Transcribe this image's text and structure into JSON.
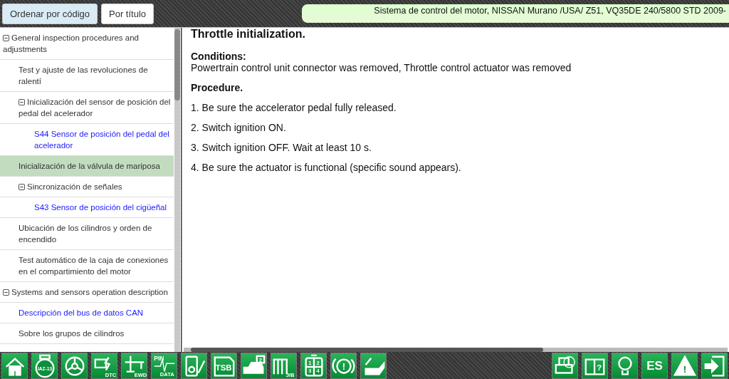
{
  "top_bar": {
    "sort_buttons": [
      {
        "label": "Ordenar por código",
        "selected": true
      },
      {
        "label": "Por título",
        "selected": false
      }
    ],
    "vehicle_info": "Sistema de control del motor, NISSAN Murano /USA/ Z51, VQ35DE 240/5800 STD 2009-"
  },
  "sidebar": {
    "items": [
      {
        "label": "General inspection procedures and adjustments",
        "kind": "topic",
        "expanded": true,
        "selected": false,
        "children": [
          {
            "label": " Test y ajuste de las revoluciones de ralentí",
            "kind": "topic",
            "expanded": false,
            "selected": false
          },
          {
            "label": "Inicialización del sensor de posición del pedal del acelerador",
            "kind": "topic",
            "expanded": true,
            "selected": false,
            "children": [
              {
                "label": " S44 Sensor de posición del pedal del acelerador",
                "kind": "link",
                "expanded": false,
                "selected": false
              }
            ]
          },
          {
            "label": "Inicialización de la válvula de mariposa",
            "kind": "topic",
            "expanded": false,
            "selected": true
          },
          {
            "label": "Sincronización de señales",
            "kind": "topic",
            "expanded": true,
            "selected": false,
            "children": [
              {
                "label": "S43 Sensor de posición del cigüeñal",
                "kind": "link",
                "expanded": false,
                "selected": false
              }
            ]
          },
          {
            "label": "Ubicación de los cilindros y orden de encendido",
            "kind": "topic",
            "expanded": false,
            "selected": false
          },
          {
            "label": "Test automático de la caja de conexiones en el compartimiento del motor",
            "kind": "topic",
            "expanded": false,
            "selected": false
          }
        ]
      },
      {
        "label": "Systems and sensors operation description",
        "kind": "topic",
        "expanded": true,
        "selected": false,
        "children": [
          {
            "label": "Descripción del bus de datos CAN",
            "kind": "link",
            "expanded": false,
            "selected": false
          },
          {
            "label": "Sobre los grupos de cilindros",
            "kind": "topic",
            "expanded": false,
            "selected": false
          }
        ]
      }
    ]
  },
  "document": {
    "title": "Throttle initialization.",
    "conditions": {
      "heading": "Conditions:",
      "text": "Powertrain control unit connector was removed, Throttle control actuator was removed"
    },
    "procedure": {
      "heading": "Procedure.",
      "steps": [
        "1. Be sure the accelerator pedal fully released.",
        "2. Switch ignition ON.",
        "3. Switch ignition OFF. Wait at least 10 s.",
        "4. Be sure the actuator is functional (specific sound appears)."
      ]
    }
  },
  "toolbar": {
    "left": [
      {
        "kind": "home"
      },
      {
        "kind": "engine",
        "labels": [
          "IAZ-13"
        ]
      },
      {
        "kind": "wheel"
      },
      {
        "kind": "dtc",
        "labels": [
          "DTC"
        ]
      },
      {
        "kind": "ewd",
        "labels": [
          "EWD"
        ]
      },
      {
        "kind": "pin",
        "labels": [
          "PIN",
          "DATA"
        ]
      },
      {
        "kind": "meter"
      },
      {
        "kind": "tsb",
        "labels": [
          "TSB"
        ]
      },
      {
        "kind": "car",
        "labels": [
          "2"
        ]
      },
      {
        "kind": "jb",
        "labels": [
          "J/B"
        ]
      },
      {
        "kind": "grid",
        "labels": [
          "1",
          "2",
          "3",
          "4"
        ]
      },
      {
        "kind": "brake",
        "labels": [
          "!"
        ]
      },
      {
        "kind": "oil"
      }
    ],
    "right": [
      {
        "kind": "print"
      },
      {
        "kind": "manual",
        "labels": [
          "?"
        ]
      },
      {
        "kind": "bulb"
      },
      {
        "kind": "lang",
        "labels": [
          "ES"
        ]
      },
      {
        "kind": "warning",
        "labels": [
          "!"
        ]
      },
      {
        "kind": "exit"
      }
    ]
  }
}
